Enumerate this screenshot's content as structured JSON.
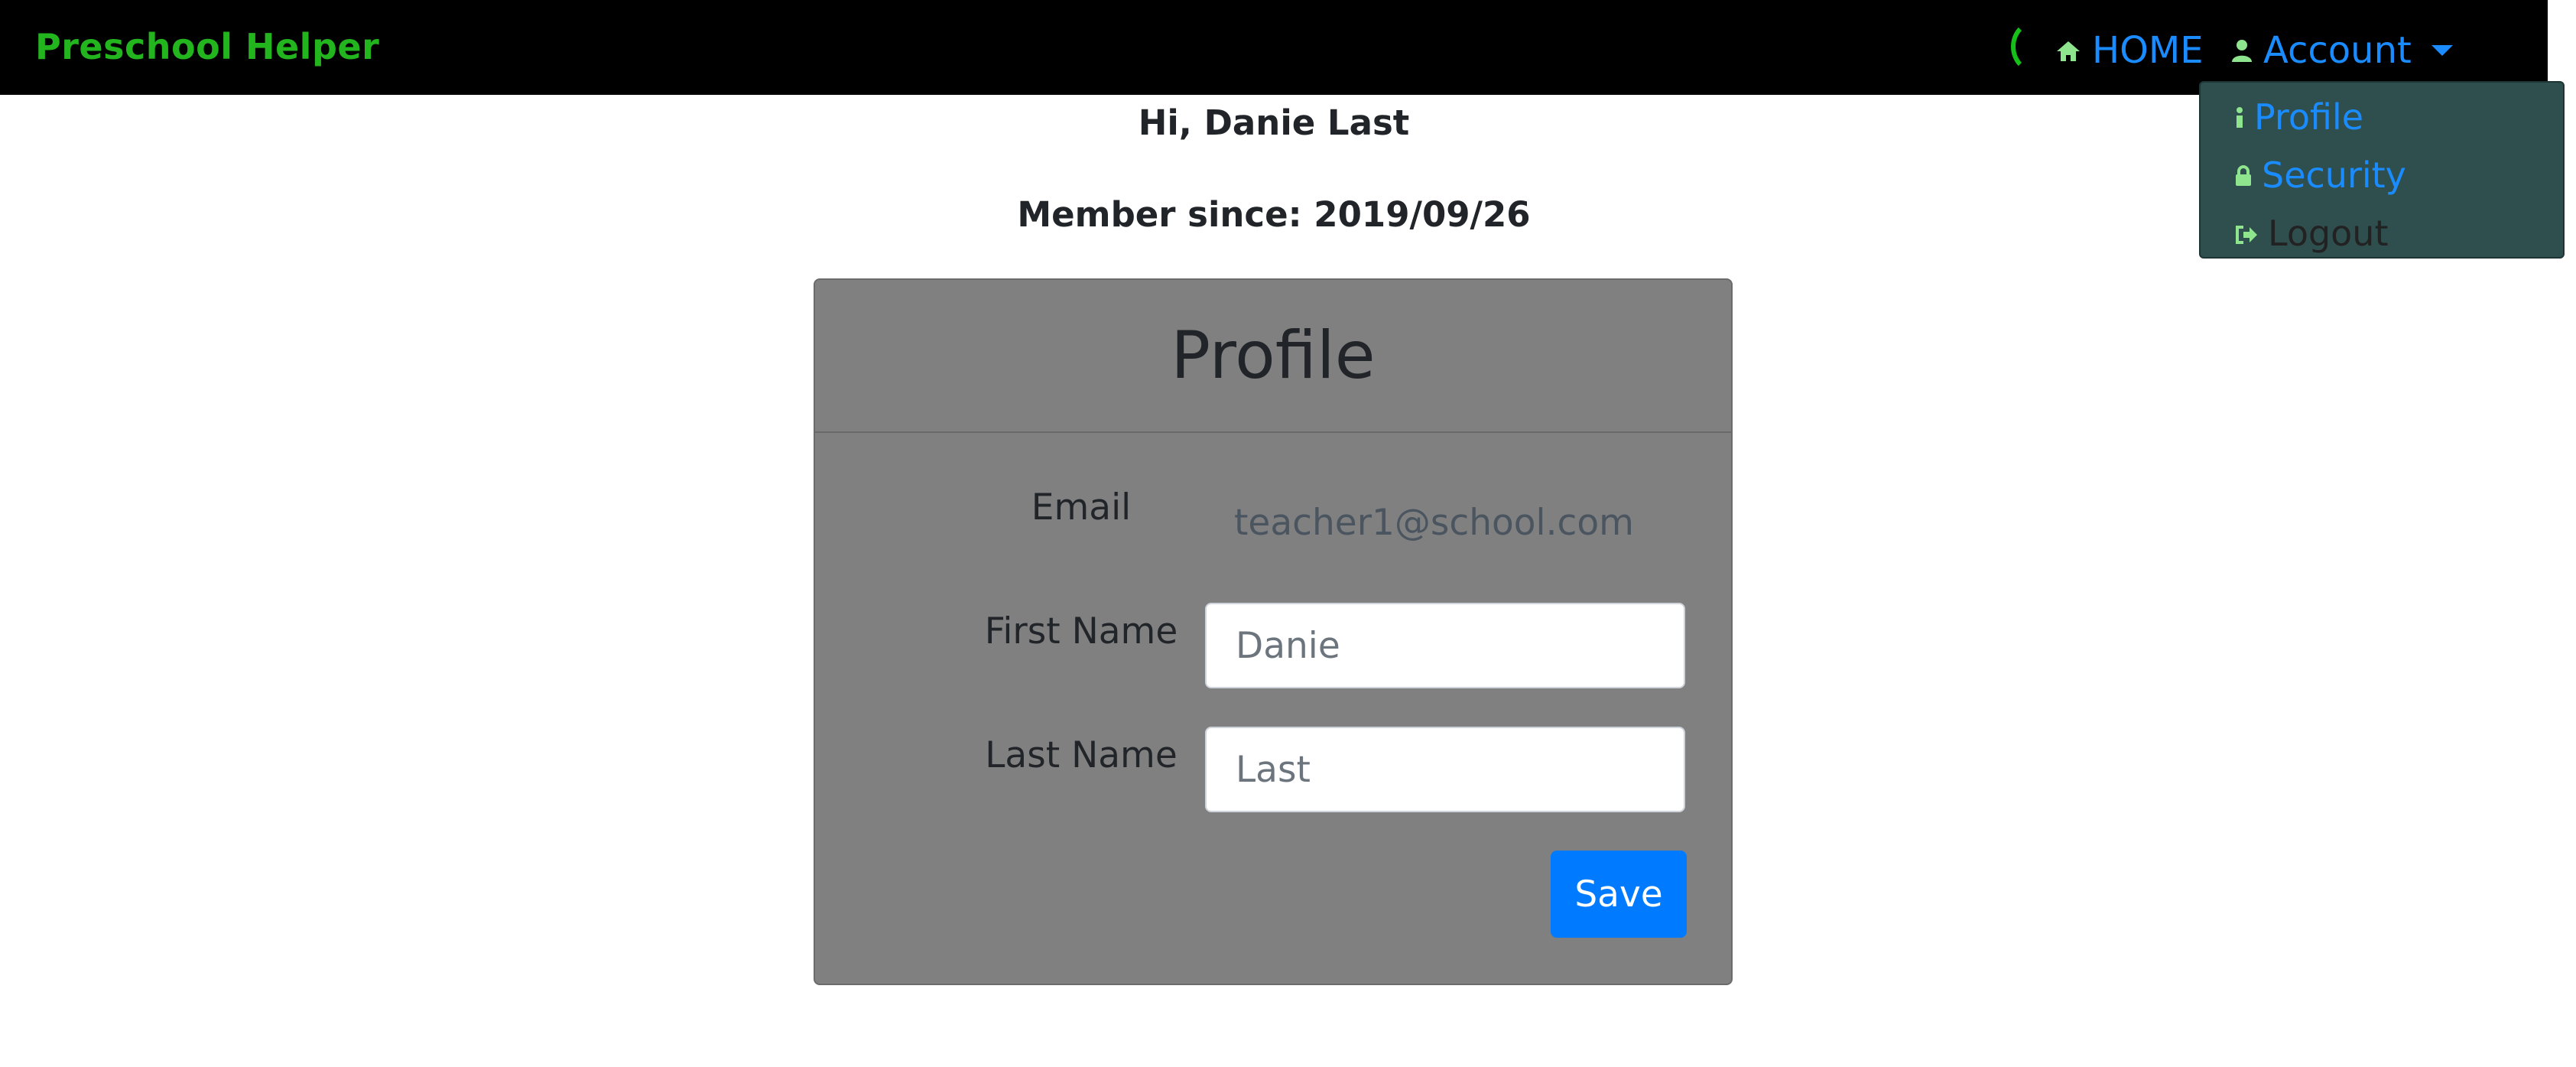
{
  "navbar": {
    "brand": "Preschool Helper",
    "home_label": "HOME",
    "account_label": "Account",
    "home_icon": "home-icon",
    "account_icon": "user-icon"
  },
  "account_menu": {
    "items": [
      {
        "label": "Profile",
        "icon": "info-icon"
      },
      {
        "label": "Security",
        "icon": "lock-icon"
      },
      {
        "label": "Logout",
        "icon": "sign-out-icon"
      }
    ]
  },
  "greeting": {
    "hi": "Hi, Danie Last",
    "member_since": "Member since: 2019/09/26"
  },
  "profile_card": {
    "title": "Profile",
    "email_label": "Email",
    "email_value": "teacher1@school.com",
    "first_name_label": "First Name",
    "first_name_placeholder": "Danie",
    "last_name_label": "Last Name",
    "last_name_placeholder": "Last",
    "save_label": "Save"
  },
  "colors": {
    "brand": "#22b51e",
    "link": "#1a8cff",
    "icon_green": "#8ee58e",
    "dropdown_bg": "#2f4f4f",
    "card_bg": "#808080",
    "primary_button": "#007bff"
  }
}
